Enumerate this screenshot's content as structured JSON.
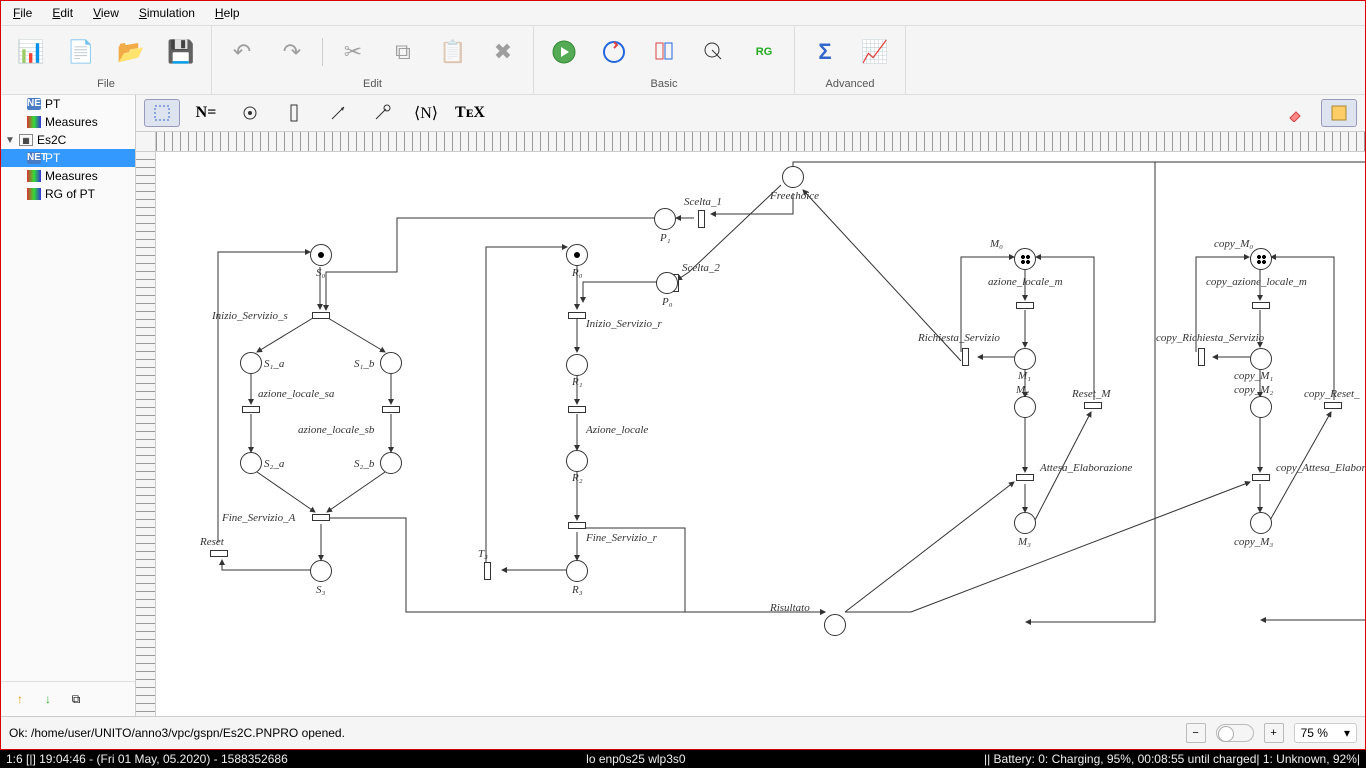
{
  "menu": {
    "file": "File",
    "edit": "Edit",
    "view": "View",
    "simulation": "Simulation",
    "help": "Help"
  },
  "toolbar_groups": {
    "file": "File",
    "edit": "Edit",
    "basic": "Basic",
    "advanced": "Advanced"
  },
  "tree": {
    "pt0": "PT",
    "measures0": "Measures",
    "project": "Es2C",
    "pt1": "PT",
    "measures1": "Measures",
    "rg": "RG of PT"
  },
  "sec": {
    "n_eq": "N=",
    "angle_n": "⟨N⟩",
    "tex": "TᴇX"
  },
  "petri": {
    "freechoice": "Freechoice",
    "scelta1": "Scelta_1",
    "p1": "P₁",
    "scelta2": "Scelta_2",
    "p0": "P₀",
    "s0": "S₀",
    "inizio_s": "Inizio_Servizio_s",
    "s1a": "S₁_a",
    "s1b": "S₁_b",
    "az_sa": "azione_locale_sa",
    "az_sb": "azione_locale_sb",
    "s2a": "S₂_a",
    "s2b": "S₂_b",
    "fine_s": "Fine_Servizio_A",
    "s3": "S₃",
    "reset": "Reset",
    "r0": "R₀",
    "inizio_r": "Inizio_Servizio_r",
    "r1": "R₁",
    "az_locale": "Azione_locale",
    "r2": "R₂",
    "fine_r": "Fine_Servizio_r",
    "t3": "T₃",
    "r3": "R₃",
    "risultato": "Risultato",
    "m0": "M₀",
    "az_m": "azione_locale_m",
    "m1": "M₁",
    "rich_serv": "Richiesta_Servizio",
    "m2": "M₂",
    "reset_m": "Reset_M",
    "attesa": "Attesa_Elaborazione",
    "m3": "M₃",
    "c_m0": "copy_M₀",
    "c_az_m": "copy_azione_locale_m",
    "c_m1": "copy_M₁",
    "c_rich": "copy_Richiesta_Servizio",
    "c_m2": "copy_M₂",
    "c_reset": "copy_Reset_",
    "c_attesa": "copy_Attesa_Elaborazione",
    "c_m3": "copy_M₃"
  },
  "status": "Ok: /home/user/UNITO/anno3/vpc/gspn/Es2C.PNPRO opened.",
  "zoom": "75 %",
  "taskbar": {
    "left": "1:6 [|]    19:04:46 - (Fri 01 May, 05.2020) - 1588352686",
    "center": "lo enp0s25 wlp3s0",
    "right": "||   Battery: 0: Charging, 95%, 00:08:55 until charged| 1: Unknown, 92%|"
  }
}
